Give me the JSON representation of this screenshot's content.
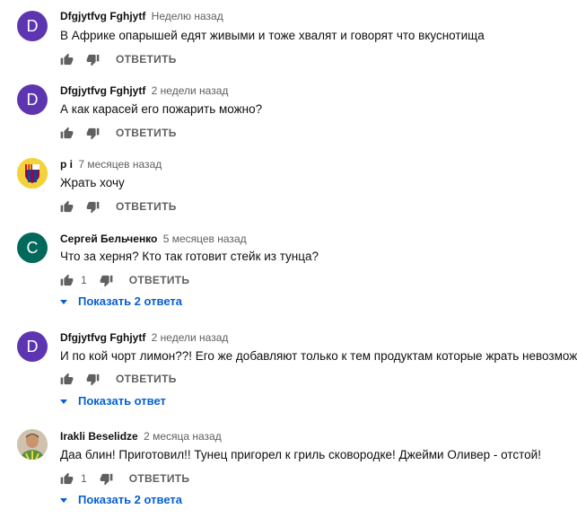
{
  "comments": [
    {
      "author": "Dfgjytfvg Fghjytf",
      "time": "Неделю назад",
      "avatar_letter": "D",
      "avatar_color": "#5e35b1",
      "text": "В Африке опарышей едят живыми и тоже хвалят и говорят что вкуснотища",
      "likes": "",
      "reply_label": "ОТВЕТИТЬ",
      "replies_label": ""
    },
    {
      "author": "Dfgjytfvg Fghjytf",
      "time": "2 недели назад",
      "avatar_letter": "D",
      "avatar_color": "#5e35b1",
      "text": "А как карасей его пожарить можно?",
      "likes": "",
      "reply_label": "ОТВЕТИТЬ",
      "replies_label": ""
    },
    {
      "author": "р і",
      "time": "7 месяцев назад",
      "avatar_letter": "",
      "avatar_color": "#1c3f8c",
      "text": "Жрать хочу",
      "likes": "",
      "reply_label": "ОТВЕТИТЬ",
      "replies_label": ""
    },
    {
      "author": "Сергей Бельченко",
      "time": "5 месяцев назад",
      "avatar_letter": "C",
      "avatar_color": "#00695c",
      "text": "Что за херня? Кто так готовит стейк из тунца?",
      "likes": "1",
      "reply_label": "ОТВЕТИТЬ",
      "replies_label": "Показать 2 ответа"
    },
    {
      "author": "Dfgjytfvg Fghjytf",
      "time": "2 недели назад",
      "avatar_letter": "D",
      "avatar_color": "#5e35b1",
      "text": "И по кой чорт лимон??! Его же добавляют только к тем продуктам которые жрать невозможно",
      "likes": "",
      "reply_label": "ОТВЕТИТЬ",
      "replies_label": "Показать ответ"
    },
    {
      "author": "Irakli Beselidze",
      "time": "2 месяца назад",
      "avatar_letter": "",
      "avatar_color": "#8a6a4a",
      "text": "Даа блин! Приготовил!! Тунец пригорел к гриль сковородке! Джейми Оливер - отстой!",
      "likes": "1",
      "reply_label": "ОТВЕТИТЬ",
      "replies_label": "Показать 2 ответа"
    }
  ]
}
